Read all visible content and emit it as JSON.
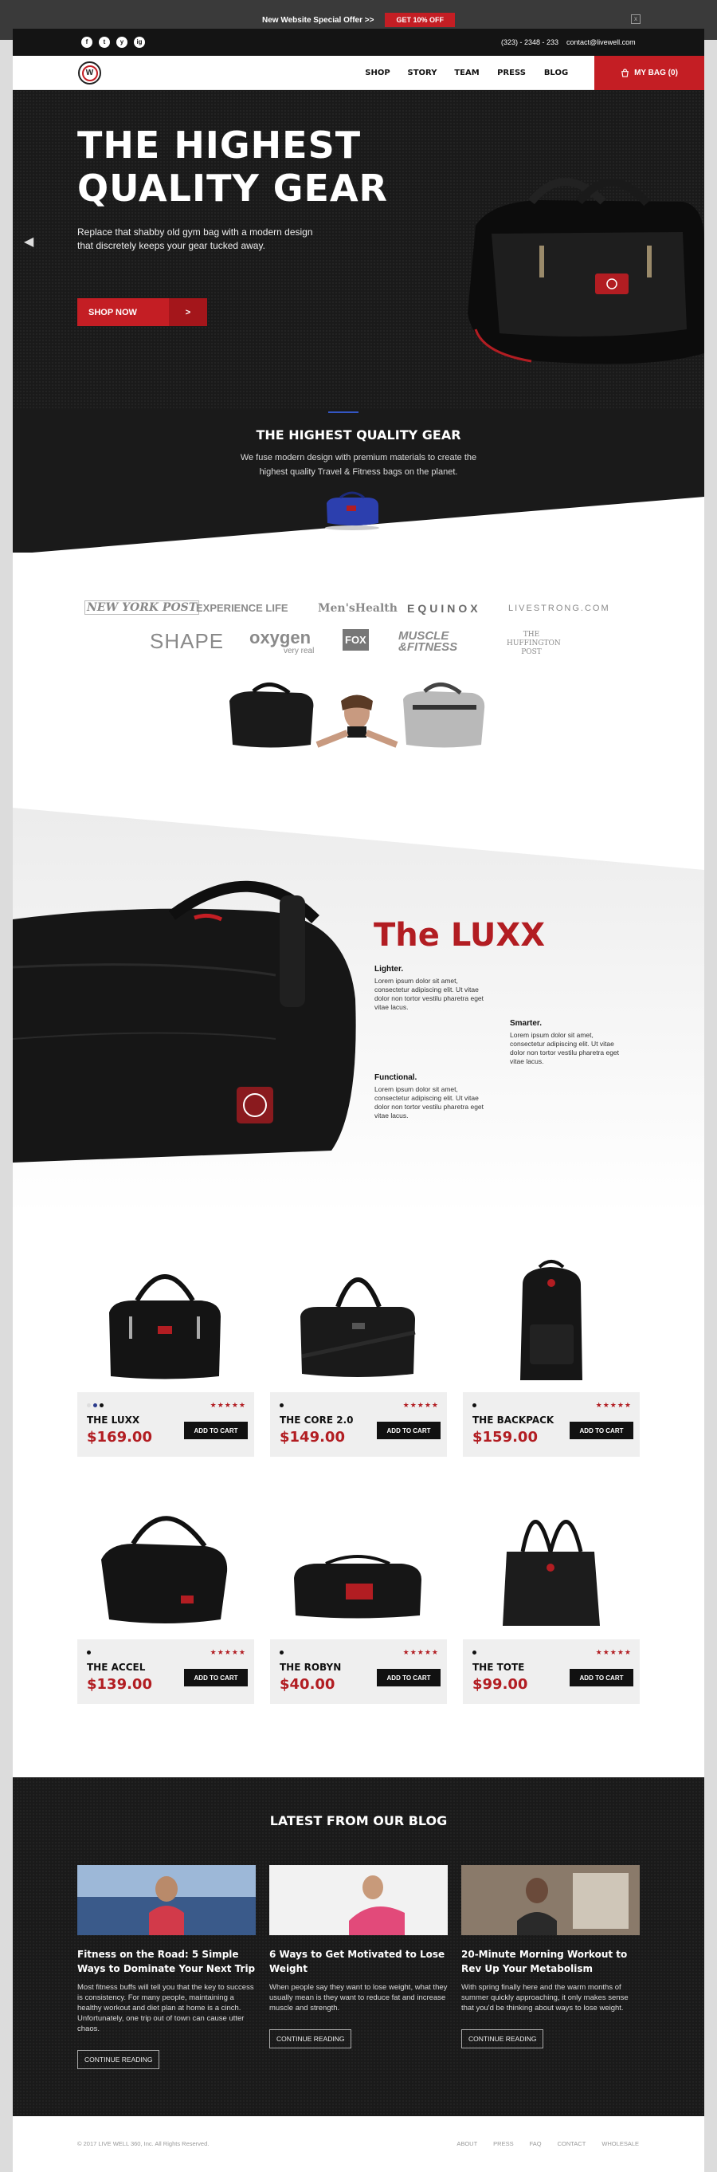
{
  "promo": {
    "text": "New Website Special Offer >>",
    "button": "GET 10% OFF",
    "close": "x"
  },
  "contact": {
    "phone": "(323) - 2348 - 233",
    "email": "contact@livewell.com"
  },
  "social": [
    "f",
    "t",
    "y",
    "ig"
  ],
  "nav": {
    "logo": "W",
    "links": [
      "SHOP",
      "STORY",
      "TEAM",
      "PRESS",
      "BLOG"
    ],
    "bag": "MY BAG (0)"
  },
  "hero": {
    "title_line1": "THE HIGHEST",
    "title_line2": "QUALITY GEAR",
    "subtitle": "Replace that shabby old gym bag with a modern design that discretely keeps your gear tucked away.",
    "button": "SHOP NOW",
    "button_arrow": ">",
    "prev": "◀",
    "next": "▶"
  },
  "intro": {
    "title": "THE HIGHEST QUALITY GEAR",
    "subtitle": "We fuse modern design with premium materials to create the highest quality Travel & Fitness bags on the planet."
  },
  "press": {
    "logos": [
      "NEW YORK POST",
      "EXPERIENCE LIFE",
      "Men'sHealth",
      "EQUINOX",
      "LIVESTRONG.COM",
      "SHAPE",
      "oxygen",
      "very real",
      "FOX",
      "MUSCLE &FITNESS",
      "THE HUFFINGTON POST"
    ]
  },
  "luxx": {
    "title": "The LUXX",
    "features": [
      {
        "title": "Lighter.",
        "text": "Lorem ipsum dolor sit amet, consectetur adipiscing elit. Ut vitae dolor non tortor vestilu pharetra eget vitae lacus."
      },
      {
        "title": "Smarter.",
        "text": "Lorem ipsum dolor sit amet, consectetur adipiscing elit. Ut vitae dolor non tortor vestilu pharetra eget vitae lacus."
      },
      {
        "title": "Functional.",
        "text": "Lorem ipsum dolor sit amet, consectetur adipiscing elit. Ut vitae dolor non tortor vestilu pharetra eget vitae lacus."
      }
    ]
  },
  "products": [
    {
      "name": "THE LUXX",
      "price": "$169.00",
      "stars": "★★★★★",
      "cart": "ADD TO CART",
      "swatches": [
        "#dddddd",
        "#2b3b8c",
        "#111111"
      ]
    },
    {
      "name": "THE CORE 2.0",
      "price": "$149.00",
      "stars": "★★★★★",
      "cart": "ADD TO CART",
      "swatches": [
        "#111111"
      ]
    },
    {
      "name": "THE BACKPACK",
      "price": "$159.00",
      "stars": "★★★★★",
      "cart": "ADD TO CART",
      "swatches": [
        "#111111"
      ]
    },
    {
      "name": "THE ACCEL",
      "price": "$139.00",
      "stars": "★★★★★",
      "cart": "ADD TO CART",
      "swatches": [
        "#111111"
      ]
    },
    {
      "name": "THE ROBYN",
      "price": "$40.00",
      "stars": "★★★★★",
      "cart": "ADD TO CART",
      "swatches": [
        "#111111"
      ]
    },
    {
      "name": "THE TOTE",
      "price": "$99.00",
      "stars": "★★★★★",
      "cart": "ADD TO CART",
      "swatches": [
        "#111111"
      ]
    }
  ],
  "blog": {
    "title": "LATEST FROM OUR BLOG",
    "posts": [
      {
        "title": "Fitness on the Road: 5 Simple Ways to Dominate Your Next Trip",
        "excerpt": "Most fitness buffs will tell you that the key to success is consistency. For many people, maintaining a healthy workout and diet plan at home is a cinch. Unfortunately, one trip out of town can cause utter chaos.",
        "button": "CONTINUE READING"
      },
      {
        "title": "6 Ways to Get Motivated to Lose Weight",
        "excerpt": "When people say they want to lose weight, what they usually mean is they want to reduce fat and increase muscle and strength.",
        "button": "CONTINUE READING"
      },
      {
        "title": "20-Minute Morning Workout to Rev Up Your Metabolism",
        "excerpt": "With spring finally here and the warm months of summer quickly approaching, it only makes sense that you'd be thinking about ways to lose weight.",
        "button": "CONTINUE READING"
      }
    ]
  },
  "footer": {
    "copyright": "© 2017 LIVE WELL 360, Inc. All Rights Reserved.",
    "links": [
      "ABOUT",
      "PRESS",
      "FAQ",
      "CONTACT",
      "WHOLESALE"
    ]
  },
  "colors": {
    "accent": "#c41e24",
    "dark": "#1a1a1a"
  }
}
